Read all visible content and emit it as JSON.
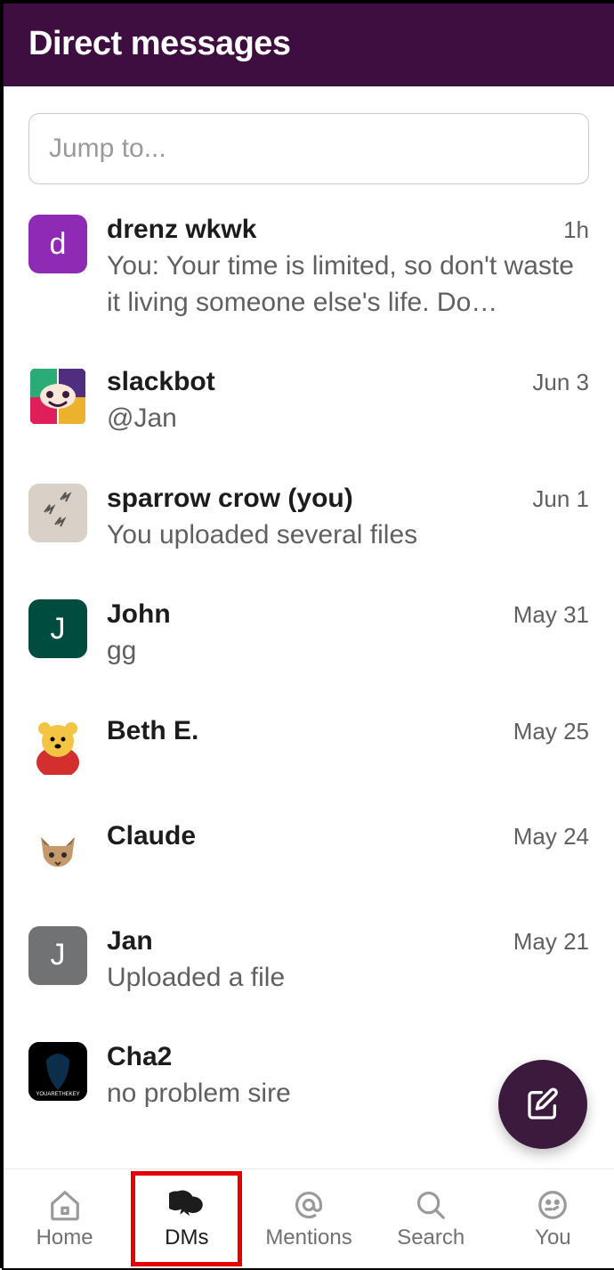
{
  "header": {
    "title": "Direct messages"
  },
  "search": {
    "placeholder": "Jump to..."
  },
  "conversations": [
    {
      "name": "drenz wkwk",
      "time": "1h",
      "msg": "You: Your time is limited, so don't waste it living someone else's life. Do…",
      "avatar": "letter",
      "letter": "d",
      "avclass": "av-purple"
    },
    {
      "name": "slackbot",
      "time": "Jun 3",
      "msg": "@Jan",
      "avatar": "slackbot",
      "avclass": "av-slackbot"
    },
    {
      "name": "sparrow crow (you)",
      "time": "Jun 1",
      "msg": "You uploaded several files",
      "avatar": "sparrow",
      "avclass": "av-img-grey"
    },
    {
      "name": "John",
      "time": "May 31",
      "msg": "gg",
      "avatar": "letter",
      "letter": "J",
      "avclass": "av-teal"
    },
    {
      "name": "Beth E.",
      "time": "May 25",
      "msg": "",
      "avatar": "pooh",
      "avclass": "av-pooh"
    },
    {
      "name": "Claude",
      "time": "May 24",
      "msg": "",
      "avatar": "cat",
      "avclass": "av-cat"
    },
    {
      "name": "Jan",
      "time": "May 21",
      "msg": "Uploaded a file",
      "avatar": "letter",
      "letter": "J",
      "avclass": "av-grey"
    },
    {
      "name": "Cha2",
      "time": "",
      "msg": "no problem sire",
      "avatar": "black",
      "avclass": "av-black"
    }
  ],
  "tabs": [
    {
      "label": "Home",
      "icon": "home-icon",
      "active": false
    },
    {
      "label": "DMs",
      "icon": "dms-icon",
      "active": true,
      "highlighted": true
    },
    {
      "label": "Mentions",
      "icon": "mentions-icon",
      "active": false
    },
    {
      "label": "Search",
      "icon": "search-icon",
      "active": false
    },
    {
      "label": "You",
      "icon": "you-icon",
      "active": false
    }
  ],
  "fab": {
    "icon": "compose-icon"
  }
}
